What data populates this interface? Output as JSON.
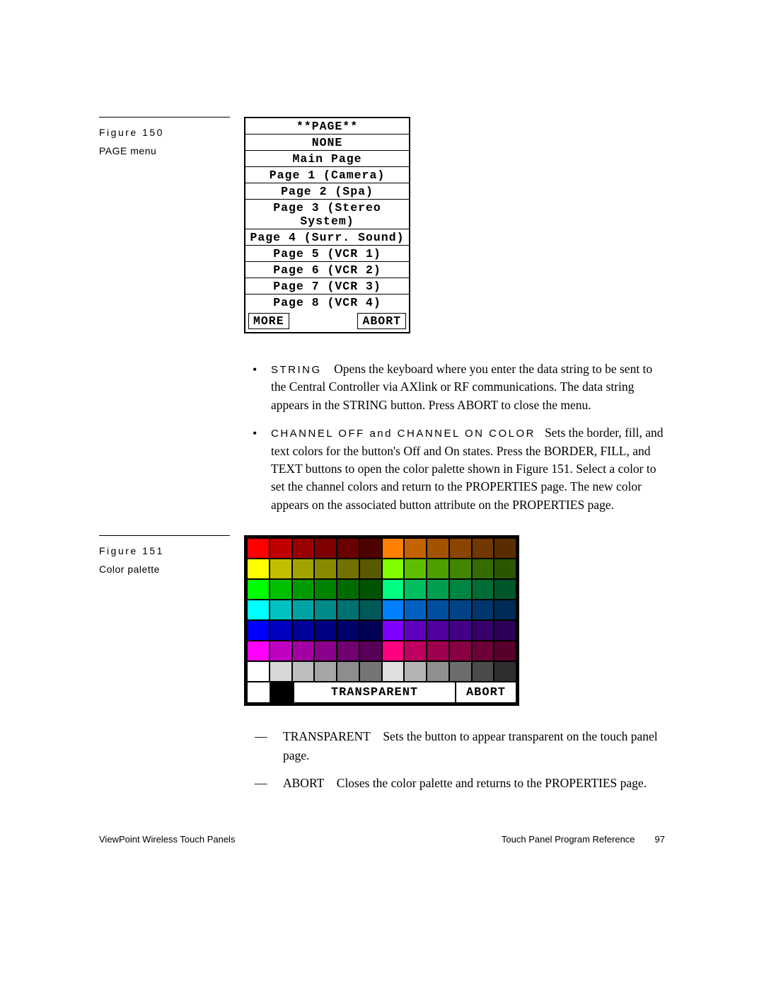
{
  "fig150": {
    "label": "Figure 150",
    "desc": "PAGE menu",
    "header": "**PAGE**",
    "items": [
      "NONE",
      "Main Page",
      "Page 1 (Camera)",
      "Page 2 (Spa)",
      "Page 3 (Stereo System)",
      "Page 4 (Surr. Sound)",
      "Page 5 (VCR 1)",
      "Page 6 (VCR 2)",
      "Page 7 (VCR 3)",
      "Page 8 (VCR 4)"
    ],
    "more": "MORE",
    "abort": "ABORT"
  },
  "bullets": {
    "b1_term": "STRING",
    "b1_text": "Opens the keyboard where you enter the data string to be sent to the Central Controller via AXlink or RF communications. The data string appears in the STRING button. Press ABORT to close the menu.",
    "b2_term": "CHANNEL OFF and CHANNEL ON COLOR",
    "b2_text": "Sets the border, fill, and text colors for the button's Off and On states. Press the BORDER, FILL, and TEXT buttons to open the color palette shown in Figure 151. Select a color to set the channel colors and return to the PROPERTIES page. The new color appears on the associated button attribute on the PROPERTIES page."
  },
  "fig151": {
    "label": "Figure 151",
    "desc": "Color palette",
    "transparent": "TRANSPARENT",
    "abort": "ABORT",
    "rows": [
      [
        "#ff0000",
        "#bf0000",
        "#9b0000",
        "#7e0000",
        "#6a0000",
        "#4f0000",
        "#ff8000",
        "#c46300",
        "#a35200",
        "#8a4500",
        "#713800",
        "#5a2d00"
      ],
      [
        "#ffff00",
        "#c0c000",
        "#a3a300",
        "#8a8a00",
        "#717100",
        "#595900",
        "#80ff00",
        "#5ebf00",
        "#4e9e00",
        "#428600",
        "#356c00",
        "#2a5600"
      ],
      [
        "#00ff00",
        "#00bf00",
        "#009b00",
        "#008300",
        "#006c00",
        "#005400",
        "#00ff80",
        "#00bf60",
        "#009e4f",
        "#008643",
        "#006c36",
        "#00562b"
      ],
      [
        "#00ffff",
        "#00c0c0",
        "#00a3a3",
        "#008a8a",
        "#007171",
        "#005959",
        "#0080ff",
        "#0060bf",
        "#004f9e",
        "#004386",
        "#00366c",
        "#002b56"
      ],
      [
        "#0000ff",
        "#0000bf",
        "#00009b",
        "#000083",
        "#00006c",
        "#000054",
        "#8000ff",
        "#6000bf",
        "#4f009e",
        "#430086",
        "#36006c",
        "#2b0056"
      ],
      [
        "#ff00ff",
        "#c000c0",
        "#a300a3",
        "#8a008a",
        "#710071",
        "#590059",
        "#ff0080",
        "#bf0060",
        "#9e004f",
        "#860043",
        "#6c0036",
        "#56002b"
      ],
      [
        "#ffffff",
        "#d7d7d7",
        "#bebebe",
        "#a6a6a6",
        "#8d8d8d",
        "#757575",
        "#e0e0e0",
        "#b4b4b4",
        "#8f8f8f",
        "#6c6c6c",
        "#4b4b4b",
        "#2e2e2e"
      ]
    ],
    "lastrow_sq": [
      "#ffffff",
      "#000000"
    ]
  },
  "sub": {
    "s1_term": "TRANSPARENT",
    "s1_text": "Sets the button to appear transparent on the touch panel page.",
    "s2_term": "ABORT",
    "s2_text": "Closes the color palette and returns to the PROPERTIES page."
  },
  "footer": {
    "left": "ViewPoint Wireless Touch Panels",
    "right": "Touch Panel Program Reference",
    "page": "97"
  }
}
